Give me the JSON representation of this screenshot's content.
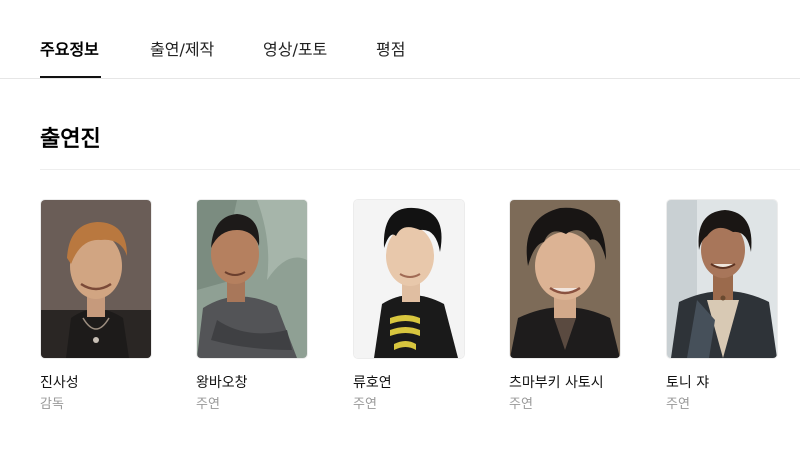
{
  "tabs": [
    {
      "label": "주요정보",
      "active": true
    },
    {
      "label": "출연/제작",
      "active": false
    },
    {
      "label": "영상/포토",
      "active": false
    },
    {
      "label": "평점",
      "active": false
    }
  ],
  "section": {
    "title": "출연진"
  },
  "cast": [
    {
      "name": "진사성",
      "role": "감독"
    },
    {
      "name": "왕바오창",
      "role": "주연"
    },
    {
      "name": "류호연",
      "role": "주연"
    },
    {
      "name": "츠마부키 사토시",
      "role": "주연"
    },
    {
      "name": "토니 쟈",
      "role": "주연"
    }
  ],
  "colors": {
    "text": "#111111",
    "muted": "#999999",
    "divider": "#e6e6e6"
  }
}
